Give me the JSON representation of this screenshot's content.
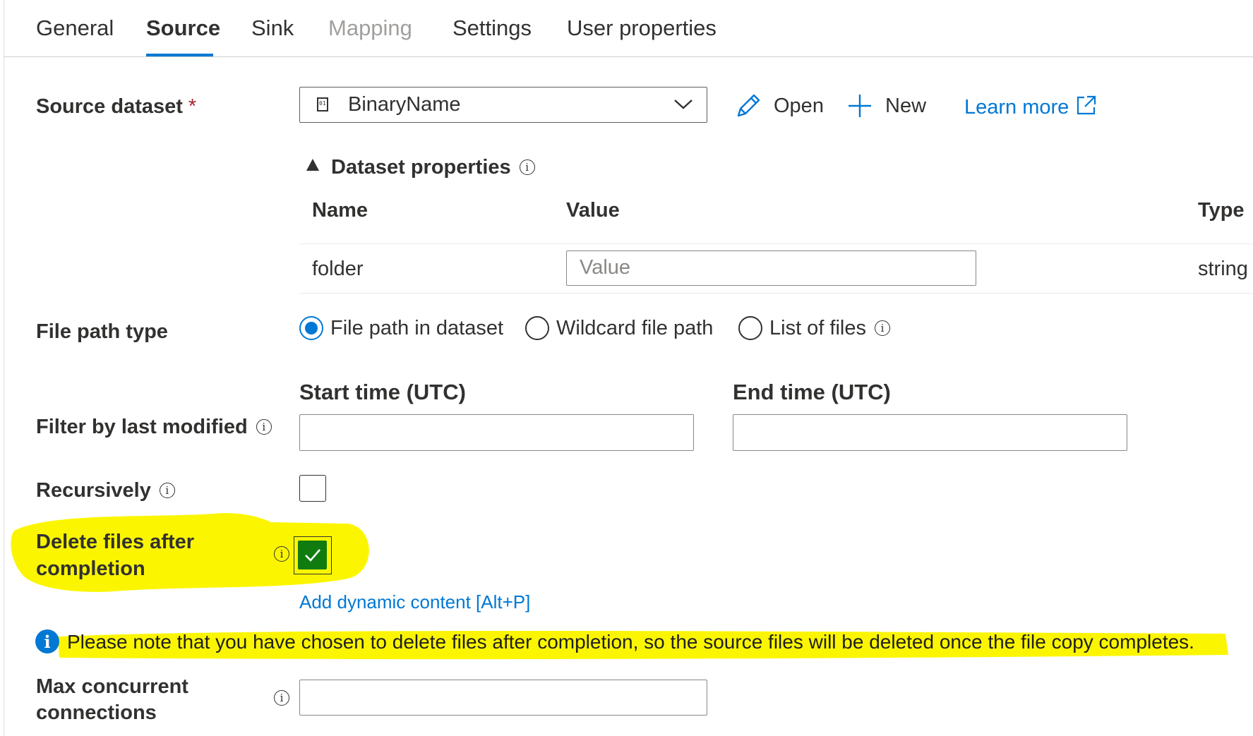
{
  "tabs": [
    {
      "label": "General",
      "state": "normal"
    },
    {
      "label": "Source",
      "state": "active"
    },
    {
      "label": "Sink",
      "state": "normal"
    },
    {
      "label": "Mapping",
      "state": "disabled"
    },
    {
      "label": "Settings",
      "state": "normal"
    },
    {
      "label": "User properties",
      "state": "normal"
    }
  ],
  "source_dataset": {
    "label": "Source dataset",
    "required_marker": "*",
    "selected": "BinaryName",
    "icon": "binary-dataset-icon",
    "open_label": "Open",
    "new_label": "New",
    "learn_more_label": "Learn more"
  },
  "dataset_properties": {
    "title": "Dataset properties",
    "columns": [
      "Name",
      "Value",
      "Type"
    ],
    "rows": [
      {
        "name": "folder",
        "value": "",
        "placeholder": "Value",
        "type": "string"
      }
    ]
  },
  "file_path_type": {
    "label": "File path type",
    "options": [
      {
        "label": "File path in dataset",
        "checked": true
      },
      {
        "label": "Wildcard file path",
        "checked": false
      },
      {
        "label": "List of files",
        "checked": false
      }
    ]
  },
  "filter": {
    "label": "Filter by last modified",
    "start_label": "Start time (UTC)",
    "end_label": "End time (UTC)",
    "start_value": "",
    "end_value": ""
  },
  "recursively": {
    "label": "Recursively",
    "checked": false
  },
  "delete_files": {
    "label_line1": "Delete files after",
    "label_line2": "completion",
    "checked": true,
    "dynamic_content_link": "Add dynamic content [Alt+P]"
  },
  "notice": {
    "text": "Please note that you have chosen to delete files after completion, so the source files will be deleted once the file copy completes."
  },
  "max_connections": {
    "label_line1": "Max concurrent",
    "label_line2": "connections",
    "value": ""
  },
  "colors": {
    "accent": "#0078d4",
    "checkbox_checked": "#107c10",
    "highlight": "#fbf600",
    "required": "#a4262c"
  }
}
